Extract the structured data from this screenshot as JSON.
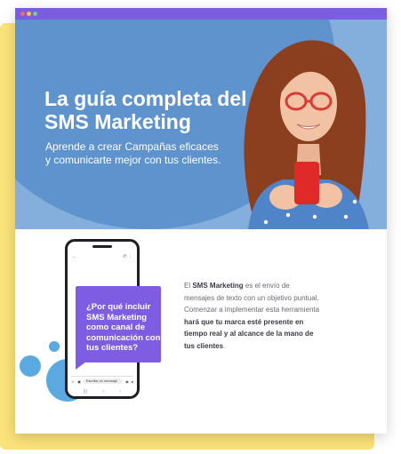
{
  "window": {
    "controls": [
      "close",
      "minimize",
      "maximize"
    ]
  },
  "hero": {
    "title": "La guía completa del SMS Marketing",
    "subtitle": "Aprende a crear Campañas eficaces y comunicarte mejor con tus clientes."
  },
  "bubble": {
    "text": "¿Por qué incluir SMS Marketing como canal de comunicación con tus clientes?"
  },
  "phone": {
    "input_placeholder": "Escribe un mensaje"
  },
  "body": {
    "p1_a": "El ",
    "p1_b": "SMS Marketing",
    "p1_c": " es el envío de mensajes de texto con un objetivo puntual. Comenzar a implementar esta herramienta ",
    "p1_d": "hará que tu marca esté presente en tiempo real y al alcance de la mano de tus clientes",
    "p1_e": "."
  },
  "colors": {
    "accent_purple": "#7e5de3",
    "hero_blue": "#5f93cd",
    "yellow": "#fbe27a"
  }
}
